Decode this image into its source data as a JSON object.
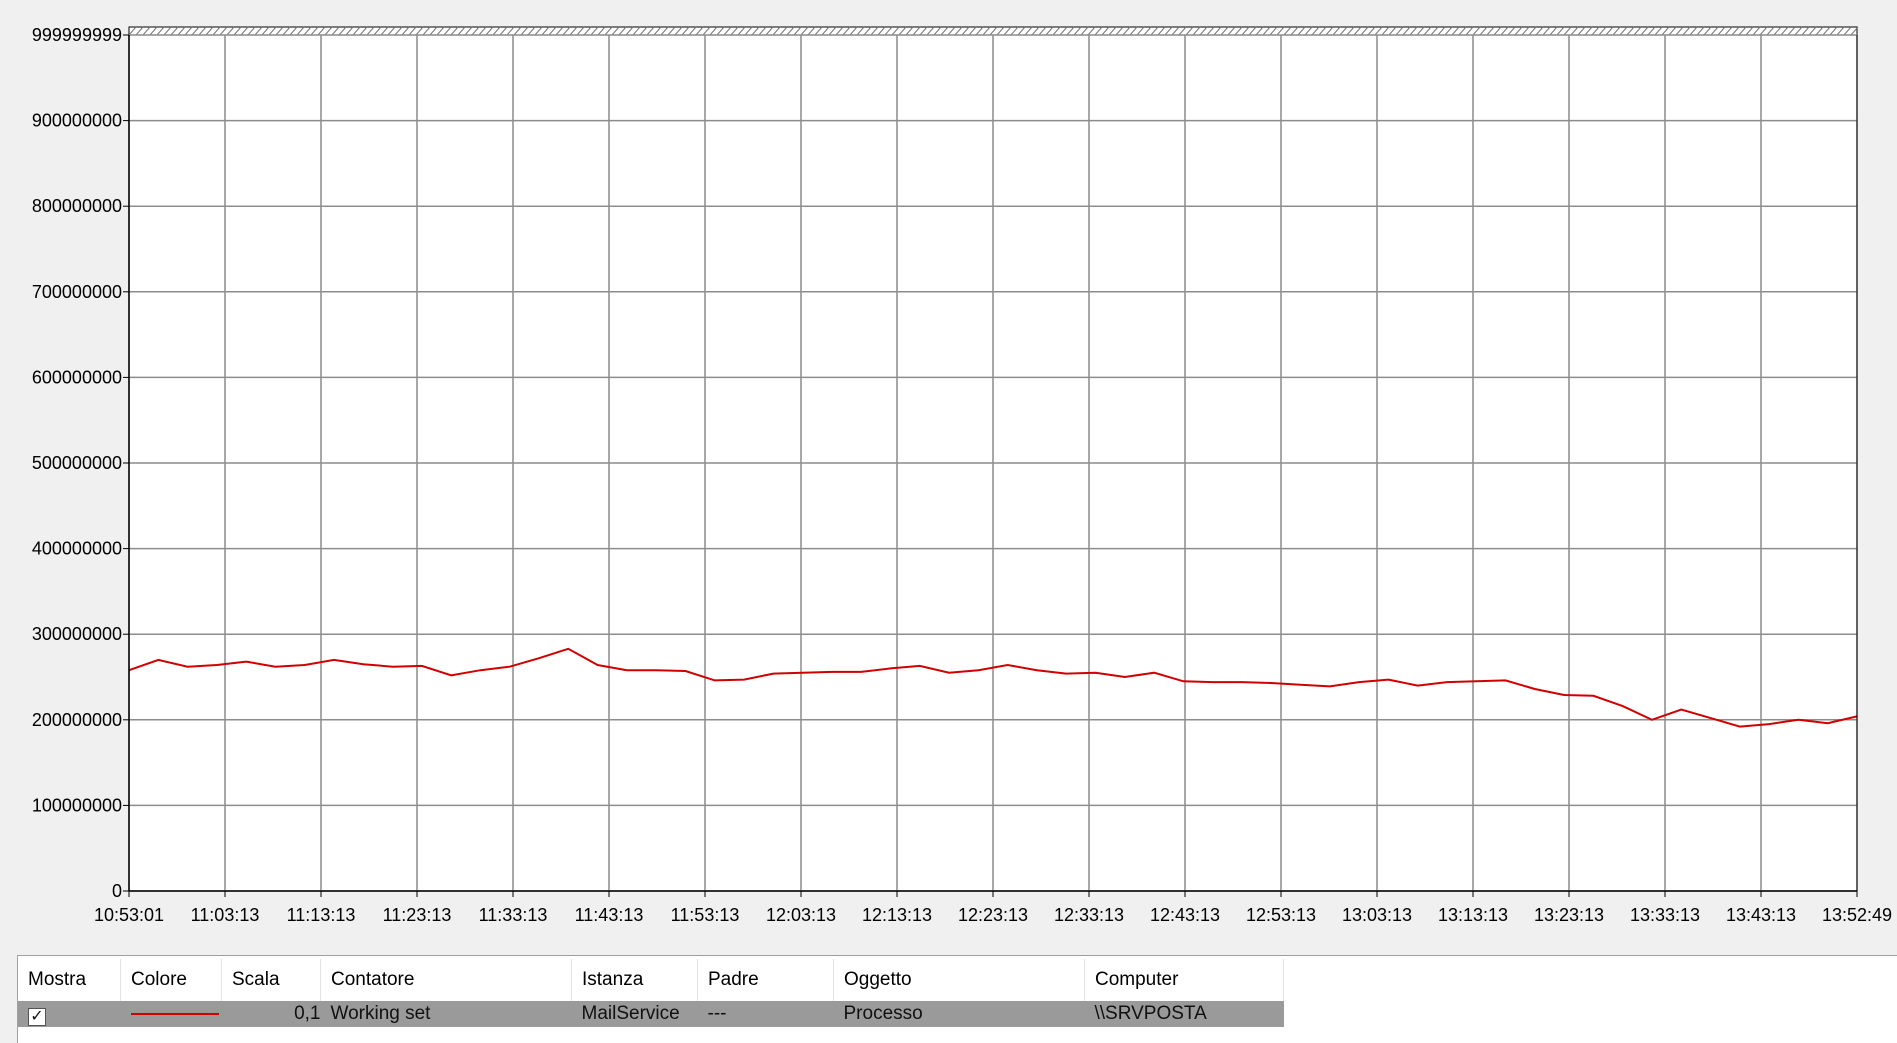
{
  "chart_data": {
    "type": "line",
    "ylim": [
      0,
      999999999
    ],
    "yticks": [
      "999999999",
      "900000000",
      "800000000",
      "700000000",
      "600000000",
      "500000000",
      "400000000",
      "300000000",
      "200000000",
      "100000000",
      "0"
    ],
    "xticks": [
      "10:53:01",
      "11:03:13",
      "11:13:13",
      "11:23:13",
      "11:33:13",
      "11:43:13",
      "11:53:13",
      "12:03:13",
      "12:13:13",
      "12:23:13",
      "12:33:13",
      "12:43:13",
      "12:53:13",
      "13:03:13",
      "13:13:13",
      "13:23:13",
      "13:33:13",
      "13:43:13",
      "13:52:49"
    ],
    "grid": true,
    "x_minutes": [
      0,
      1,
      2,
      3,
      4,
      5,
      6,
      7,
      8,
      9,
      10,
      11,
      12,
      13,
      14,
      15,
      16,
      17,
      18,
      19,
      20,
      21,
      22,
      23,
      24,
      25,
      26,
      27,
      28,
      29,
      30,
      31,
      32,
      33,
      34,
      35,
      36,
      37,
      38,
      39,
      40,
      41,
      42,
      43,
      44,
      45,
      46,
      47,
      48,
      49,
      50,
      51,
      52,
      53,
      54,
      55,
      56,
      57,
      58,
      59
    ],
    "series": [
      {
        "color": "#d00000",
        "values": [
          258000000,
          270000000,
          262000000,
          264000000,
          268000000,
          262000000,
          264000000,
          270000000,
          265000000,
          262000000,
          263000000,
          252000000,
          258000000,
          262000000,
          272000000,
          283000000,
          264000000,
          258000000,
          258000000,
          257000000,
          246000000,
          247000000,
          254000000,
          255000000,
          256000000,
          256000000,
          260000000,
          263000000,
          255000000,
          258000000,
          264000000,
          258000000,
          254000000,
          255000000,
          250000000,
          255000000,
          245000000,
          244000000,
          244000000,
          243000000,
          241000000,
          239000000,
          244000000,
          247000000,
          240000000,
          244000000,
          245000000,
          246000000,
          236000000,
          229000000,
          228000000,
          216000000,
          200000000,
          212000000,
          202000000,
          192000000,
          195000000,
          200000000,
          196000000,
          204000000
        ]
      }
    ]
  },
  "legend_table": {
    "headers": [
      "Mostra",
      "Colore",
      "Scala",
      "Contatore",
      "Istanza",
      "Padre",
      "Oggetto",
      "Computer"
    ],
    "row": {
      "show": "✓",
      "color": "#d00000",
      "scale": "0,1",
      "counter": "Working set",
      "instance": "MailService",
      "parent": "---",
      "object": "Processo",
      "computer": "\\\\SRVPOSTA"
    }
  }
}
